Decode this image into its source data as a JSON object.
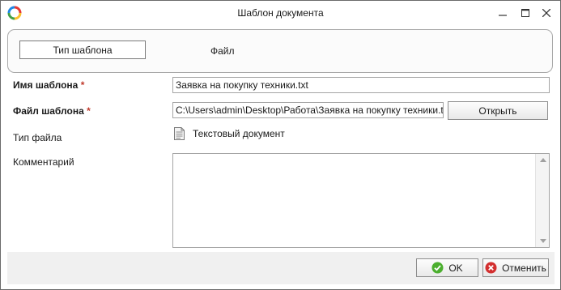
{
  "window": {
    "title": "Шаблон документа"
  },
  "icons": {
    "app": "app-logo-ring",
    "minimize": "minimize-icon",
    "maximize": "maximize-icon",
    "close": "close-icon",
    "file_type": "text-document-icon",
    "ok": "check-circle-icon",
    "cancel": "cancel-circle-icon"
  },
  "colors": {
    "required_marker": "#c0392b",
    "ok_icon": "#4caf2f",
    "cancel_icon": "#d32f2f"
  },
  "tabs": {
    "template_type": "Тип шаблона",
    "file": "Файл"
  },
  "form": {
    "name_label": "Имя шаблона",
    "name_required": "*",
    "name_value": "Заявка на покупку техники.txt",
    "file_label": "Файл шаблона",
    "file_required": "*",
    "file_value": "C:\\Users\\admin\\Desktop\\Работа\\Заявка на покупку техники.txt",
    "open_button": "Открыть",
    "file_type_label": "Тип файла",
    "file_type_value": "Текстовый документ",
    "comment_label": "Комментарий",
    "comment_value": ""
  },
  "footer": {
    "ok_button": "OK",
    "cancel_button": "Отменить"
  }
}
